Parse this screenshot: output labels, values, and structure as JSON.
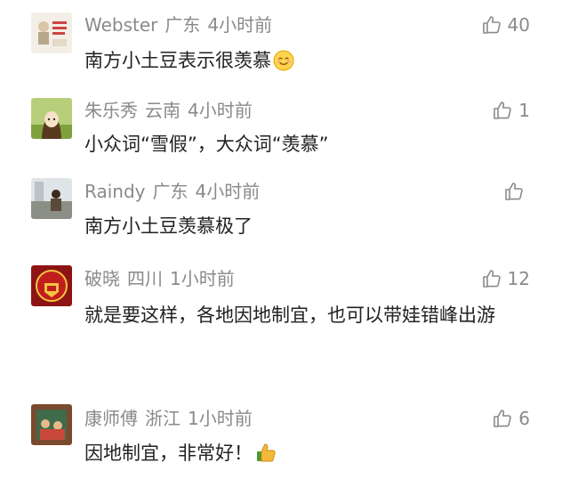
{
  "comments": [
    {
      "user": "Webster",
      "location": "广东",
      "time": "4小时前",
      "likes": "40",
      "text": "南方小土豆表示很羡慕"
    },
    {
      "user": "朱乐秀",
      "location": "云南",
      "time": "4小时前",
      "likes": "1",
      "text": "小众词“雪假”，大众词“羡慕”"
    },
    {
      "user": "Raindy",
      "location": "广东",
      "time": "4小时前",
      "likes": "",
      "text": "南方小土豆羡慕极了"
    },
    {
      "user": "破晓",
      "location": "四川",
      "time": "1小时前",
      "likes": "12",
      "text": "就是要这样，各地因地制宜，也可以带娃错峰出游"
    },
    {
      "user": "康师傅",
      "location": "浙江",
      "time": "1小时前",
      "likes": "6",
      "text": "因地制宜，非常好！"
    }
  ],
  "icons": {
    "like": "thumbs-up-outline-icon",
    "emoji_smile": "smiling-face-emoji",
    "emoji_thumbs": "thumbs-up-emoji"
  }
}
